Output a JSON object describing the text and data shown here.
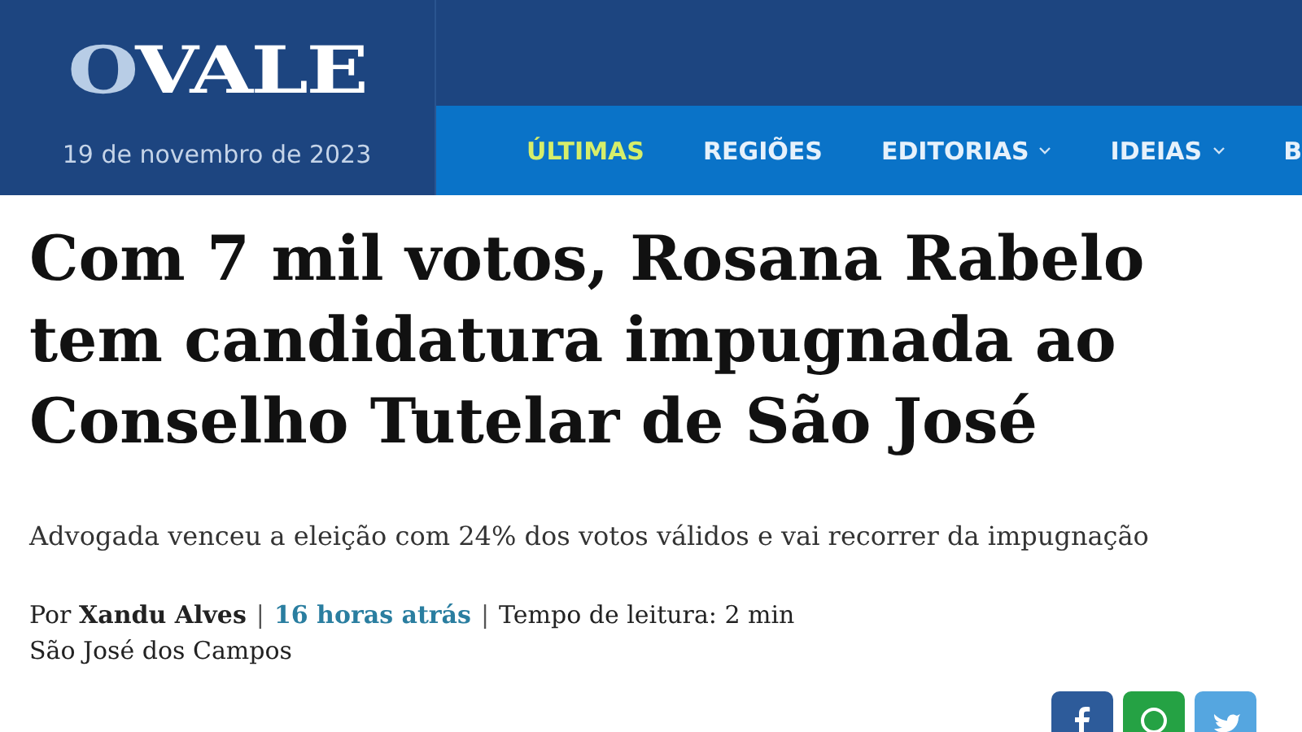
{
  "header": {
    "logo": {
      "first": "O",
      "rest": "VALE"
    },
    "date": "19 de novembro de 2023"
  },
  "nav": [
    {
      "label": "ÚLTIMAS",
      "selected": true,
      "dropdown": false
    },
    {
      "label": "REGIÕES",
      "selected": false,
      "dropdown": false
    },
    {
      "label": "EDITORIAS",
      "selected": false,
      "dropdown": true
    },
    {
      "label": "IDEIAS",
      "selected": false,
      "dropdown": true
    },
    {
      "label": "B",
      "selected": false,
      "dropdown": false
    }
  ],
  "article": {
    "headline": "Com 7 mil votos, Rosana Rabelo tem candidatura impugnada ao Conselho Tutelar de São José",
    "subtitle": "Advogada venceu a eleição com 24% dos votos válidos e vai recorrer da impugnação",
    "byline": {
      "author": "Por **Xandu Alves**",
      "separators": [
        "|",
        "|"
      ],
      "time": "16 horas atrás",
      "reading_time": "Tempo de leitura: 2 min"
    },
    "location": "São José dos Campos"
  },
  "share_buttons": [
    {
      "kind": "facebook",
      "color": "#2d5b9a"
    },
    {
      "kind": "whatsapp",
      "color": "#25a244"
    },
    {
      "kind": "twitter",
      "color": "#55a6e0"
    }
  ]
}
